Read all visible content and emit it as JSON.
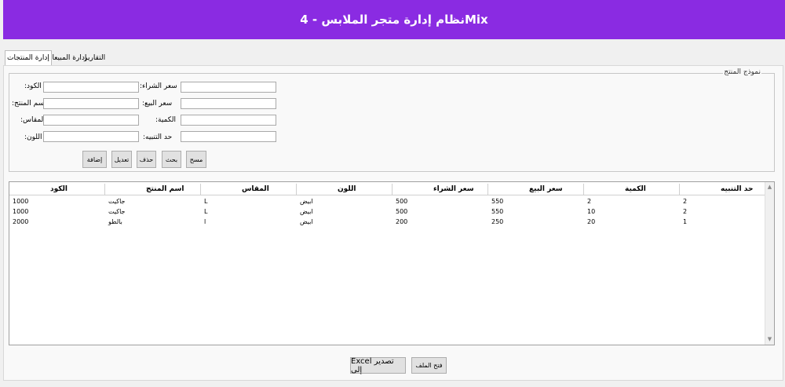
{
  "app": {
    "title": "نظام إدارة متجر الملابس - 4Mix"
  },
  "tabs": [
    {
      "label": "إدارة المنتجات",
      "active": true
    },
    {
      "label": "إدارة المبيعات",
      "active": false
    },
    {
      "label": "التقارير",
      "active": false
    }
  ],
  "form": {
    "legend": "نموذج المنتج",
    "fields": [
      {
        "label": ":الكود",
        "value": ""
      },
      {
        "label": ":اسم المنتج",
        "value": ""
      },
      {
        "label": ":المقاس",
        "value": ""
      },
      {
        "label": ":اللون",
        "value": ""
      },
      {
        "label": ":سعر الشراء",
        "value": ""
      },
      {
        "label": ":سعر البيع",
        "value": ""
      },
      {
        "label": ":الكمية",
        "value": ""
      },
      {
        "label": ":حد التنبيه",
        "value": ""
      }
    ],
    "buttons": {
      "add": "إضافة",
      "edit": "تعديل",
      "delete": "حذف",
      "search": "بحث",
      "clear": "مسح"
    }
  },
  "table": {
    "columns": [
      "حد التنبيه",
      "الكمية",
      "سعر البيع",
      "سعر الشراء",
      "اللون",
      "المقاس",
      "اسم المنتج",
      "الكود"
    ],
    "rows": [
      [
        "2",
        "2",
        "550",
        "500",
        "ابيض",
        "L",
        "جاكيت",
        "1000"
      ],
      [
        "2",
        "10",
        "550",
        "500",
        "ابيض",
        "L",
        "جاكيت",
        "1000"
      ],
      [
        "1",
        "20",
        "250",
        "200",
        "ابيض",
        "l",
        "بالطو",
        "2000"
      ]
    ]
  },
  "footer": {
    "open_file": "فتح الملف",
    "export_excel": "Excel تصدير إلى"
  },
  "colors": {
    "header": "#8a2be2"
  }
}
